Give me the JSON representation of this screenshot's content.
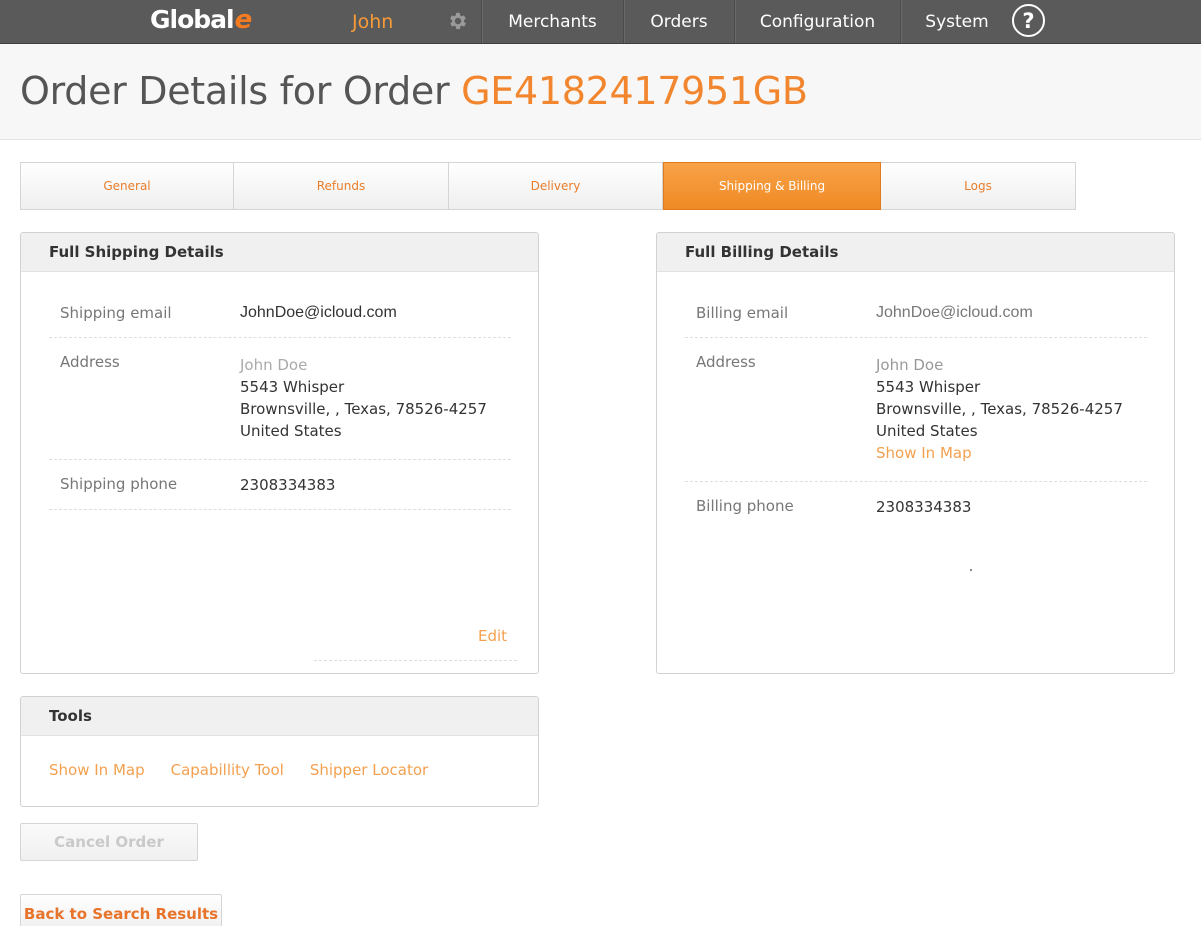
{
  "topbar": {
    "logo_text": "Global",
    "logo_accent": "e",
    "user_name": "John",
    "nav": [
      "Merchants",
      "Orders",
      "Configuration",
      "System"
    ],
    "help_glyph": "?"
  },
  "page": {
    "title_prefix": "Order Details for Order ",
    "order_id": "GE4182417951GB"
  },
  "tabs": [
    {
      "label": "General",
      "active": false
    },
    {
      "label": "Refunds",
      "active": false
    },
    {
      "label": "Delivery",
      "active": false
    },
    {
      "label": "Shipping & Billing",
      "active": true
    },
    {
      "label": "Logs",
      "active": false
    }
  ],
  "shipping": {
    "title": "Full Shipping Details",
    "email_label": "Shipping email",
    "email": "JohnDoe@icloud.com",
    "address_label": "Address",
    "name": "John Doe",
    "street": "5543 Whisper",
    "city_line": "Brownsville, , Texas, 78526-4257",
    "country": "United States",
    "phone_label": "Shipping phone",
    "phone": "2308334383",
    "edit_label": "Edit"
  },
  "billing": {
    "title": "Full Billing Details",
    "email_label": "Billing email",
    "email": "JohnDoe@icloud.com",
    "address_label": "Address",
    "name": "John Doe",
    "street": "5543 Whisper",
    "city_line": "Brownsville, , Texas, 78526-4257",
    "country": "United States",
    "map_link": "Show In Map",
    "phone_label": "Billing phone",
    "phone": "2308334383"
  },
  "tools": {
    "title": "Tools",
    "links": [
      "Show In Map",
      "Capabillity Tool",
      "Shipper Locator"
    ]
  },
  "buttons": {
    "cancel_order": "Cancel Order",
    "back": "Back to Search Results"
  },
  "colors": {
    "accent": "#f2862e",
    "topbar": "#5a5a5a",
    "link": "#f4a04f"
  }
}
